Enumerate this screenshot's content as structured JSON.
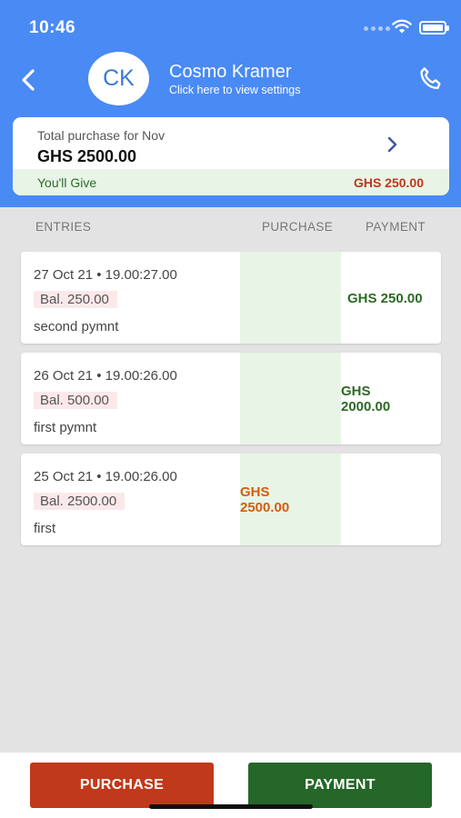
{
  "status_bar": {
    "time": "10:46"
  },
  "header": {
    "avatar_initials": "CK",
    "contact_name": "Cosmo Kramer",
    "contact_subtitle": "Click here to view settings"
  },
  "summary": {
    "label": "Total purchase for Nov",
    "amount": "GHS  2500.00",
    "give_label": "You'll Give",
    "give_amount": "GHS 250.00"
  },
  "columns": {
    "entries": "ENTRIES",
    "purchase": "PURCHASE",
    "payment": "PAYMENT"
  },
  "entries": [
    {
      "date": "27 Oct 21 • 19.00:27.00",
      "balance": "Bal. 250.00",
      "note": "second pymnt",
      "purchase": "",
      "payment": "GHS  250.00"
    },
    {
      "date": "26 Oct 21 • 19.00:26.00",
      "balance": "Bal. 500.00",
      "note": "first pymnt",
      "purchase": "",
      "payment_line1": "GHS",
      "payment_line2": "2000.00"
    },
    {
      "date": "25 Oct 21 • 19.00:26.00",
      "balance": "Bal. 2500.00",
      "note": "first",
      "purchase_line1": "GHS",
      "purchase_line2": "2500.00",
      "payment": ""
    }
  ],
  "actions": {
    "purchase_label": "PURCHASE",
    "payment_label": "PAYMENT"
  },
  "icons": {
    "back": "chevron-left-icon",
    "call": "phone-icon",
    "summary_open": "chevron-right-icon",
    "wifi": "wifi-icon",
    "battery": "battery-icon",
    "signal": "signal-icon"
  },
  "colors": {
    "header_bg": "#4a8af4",
    "purchase": "#c0391b",
    "payment": "#256728",
    "give_amount": "#c1361b",
    "purchase_amount": "#d35d0e",
    "payment_amount": "#2c6a25"
  }
}
